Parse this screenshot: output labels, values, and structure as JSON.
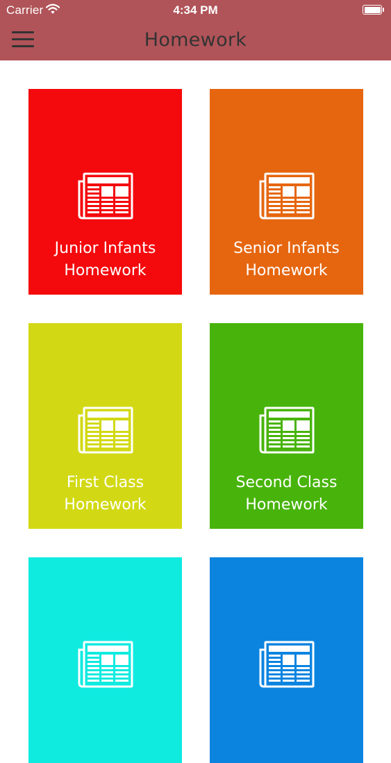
{
  "status_bar": {
    "carrier": "Carrier",
    "time": "4:34 PM",
    "wifi_icon": "wifi-icon",
    "battery_icon": "battery-icon"
  },
  "header": {
    "title": "Homework",
    "menu_icon": "hamburger-menu-icon",
    "background_color": "#b05459"
  },
  "tiles": [
    {
      "line1": "Junior Infants",
      "line2": "Homework",
      "color": "#f4090c",
      "icon": "newspaper-icon"
    },
    {
      "line1": "Senior Infants",
      "line2": "Homework",
      "color": "#e6660f",
      "icon": "newspaper-icon"
    },
    {
      "line1": "First Class",
      "line2": "Homework",
      "color": "#d2d914",
      "icon": "newspaper-icon"
    },
    {
      "line1": "Second Class",
      "line2": "Homework",
      "color": "#48b40b",
      "icon": "newspaper-icon"
    },
    {
      "line1": "",
      "line2": "",
      "color": "#10ebe0",
      "icon": "newspaper-icon"
    },
    {
      "line1": "",
      "line2": "",
      "color": "#0b84e0",
      "icon": "newspaper-icon"
    }
  ]
}
